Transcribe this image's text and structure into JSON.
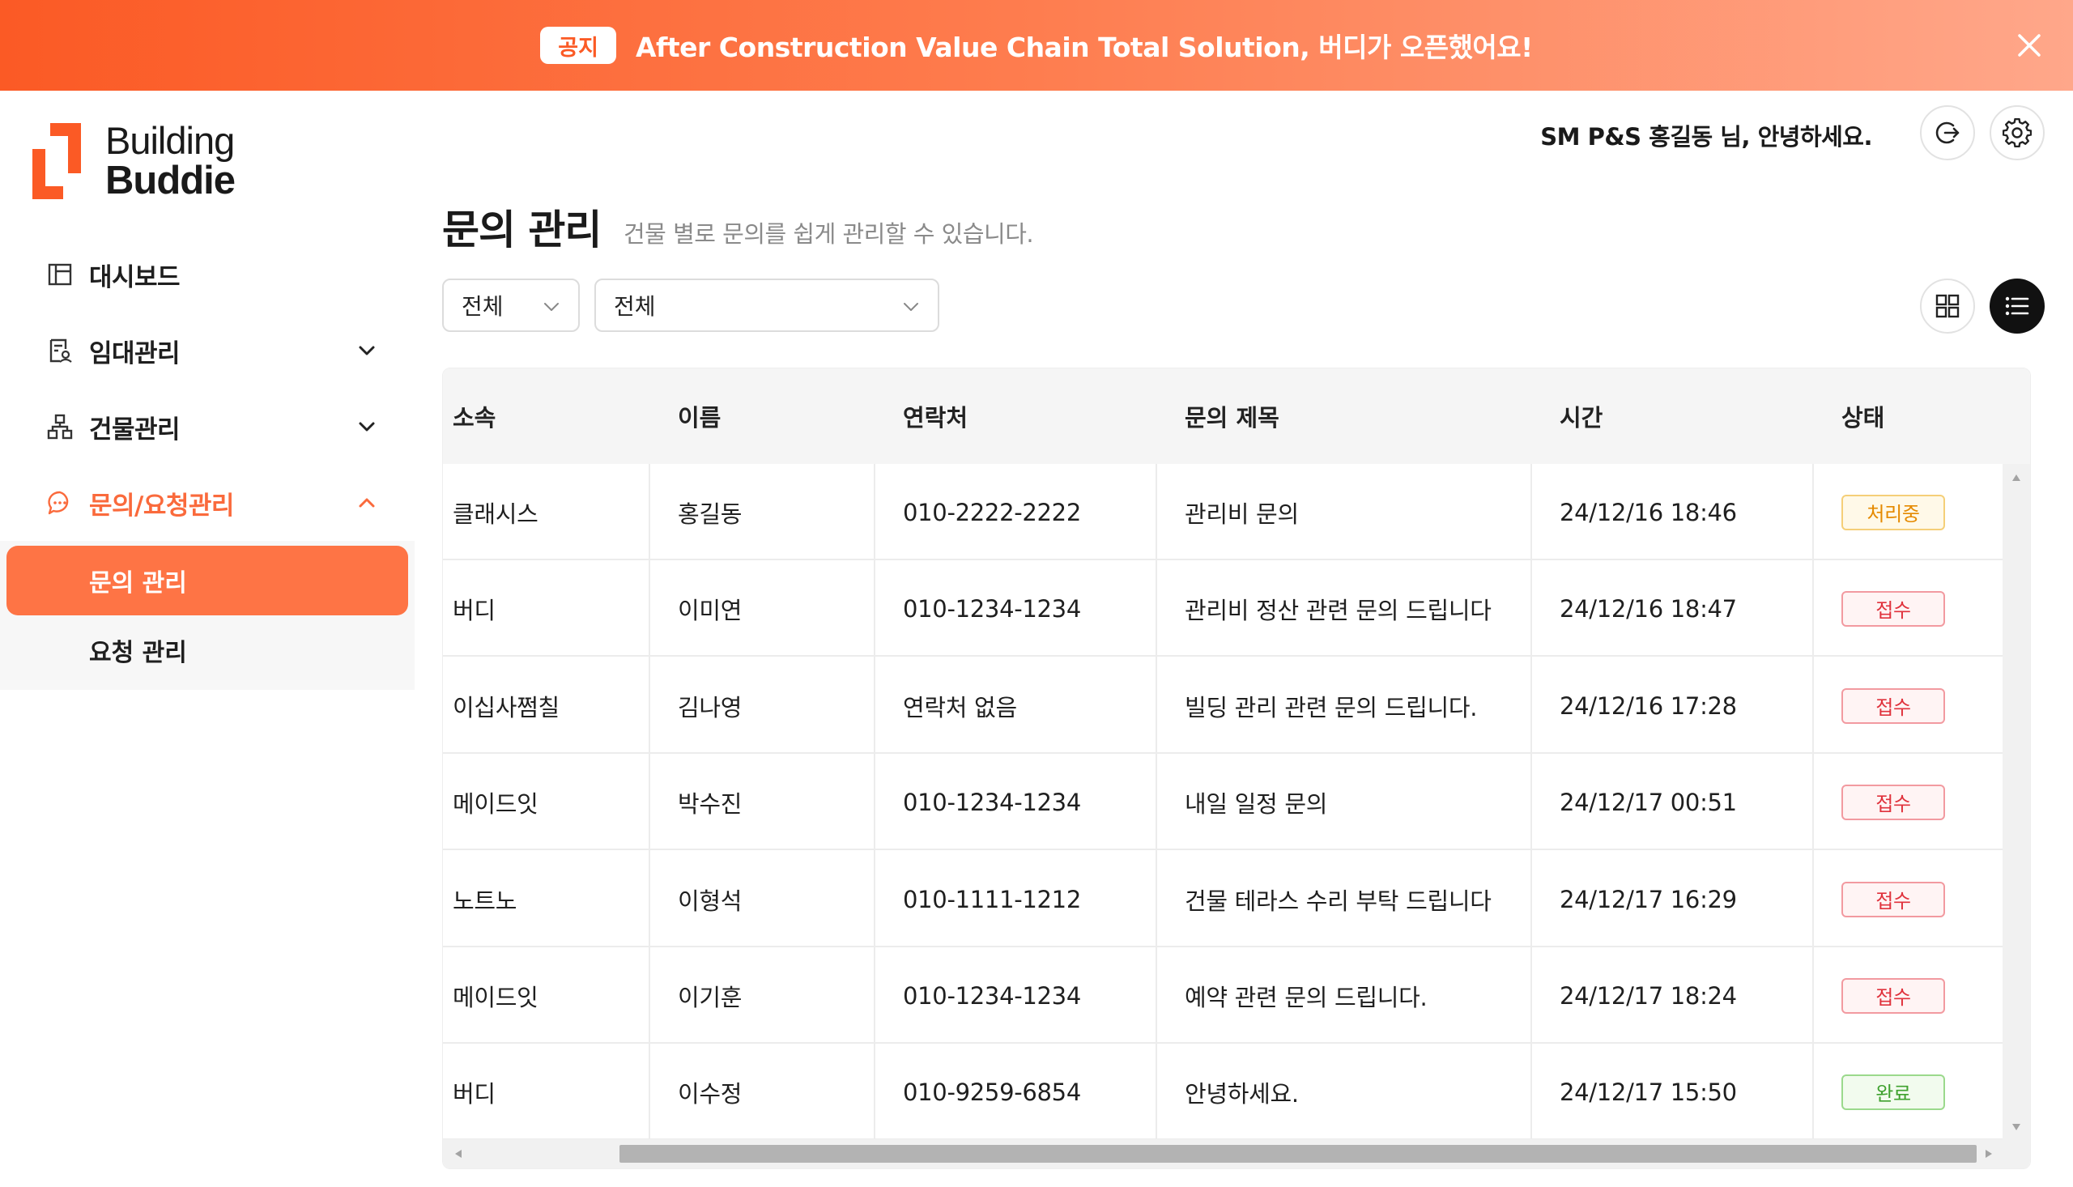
{
  "banner": {
    "badge": "공지",
    "text": "After Construction Value Chain Total Solution, 버디가 오픈했어요!",
    "close_icon": "close-icon"
  },
  "brand": {
    "line1": "Building",
    "line2": "Buddie",
    "accent": "#fb5a25"
  },
  "sidebar": {
    "items": [
      {
        "label": "대시보드",
        "icon": "dashboard-icon"
      },
      {
        "label": "임대관리",
        "icon": "contract-icon",
        "chevron": "chevron-down-icon"
      },
      {
        "label": "건물관리",
        "icon": "org-tree-icon",
        "chevron": "chevron-down-icon"
      },
      {
        "label": "문의/요청관리",
        "icon": "chat-icon",
        "chevron": "chevron-up-icon"
      }
    ],
    "sub_items": [
      {
        "label": "문의 관리"
      },
      {
        "label": "요청 관리"
      }
    ]
  },
  "header": {
    "greeting": "SM P&S 홍길동 님, 안녕하세요.",
    "logout_icon": "logout-icon",
    "settings_icon": "gear-icon"
  },
  "page": {
    "title": "문의 관리",
    "subtitle": "건물 별로 문의를 쉽게 관리할 수 있습니다."
  },
  "filters": {
    "first_value": "전체",
    "second_value": "전체"
  },
  "view_toggle": {
    "grid_icon": "grid-icon",
    "list_icon": "list-icon",
    "active": "list"
  },
  "table": {
    "columns": [
      "소속",
      "이름",
      "연락처",
      "문의 제목",
      "시간",
      "상태"
    ],
    "rows": [
      {
        "org": "클래시스",
        "name": "홍길동",
        "phone": "010-2222-2222",
        "subject": "관리비 문의",
        "time": "24/12/16 18:46",
        "status": "처리중"
      },
      {
        "org": "버디",
        "name": "이미연",
        "phone": "010-1234-1234",
        "subject": "관리비 정산 관련 문의 드립니다",
        "time": "24/12/16 18:47",
        "status": "접수"
      },
      {
        "org": "이십사쩜칠",
        "name": "김나영",
        "phone": "연락처 없음",
        "subject": "빌딩 관리 관련 문의 드립니다.",
        "time": "24/12/16 17:28",
        "status": "접수"
      },
      {
        "org": "메이드잇",
        "name": "박수진",
        "phone": "010-1234-1234",
        "subject": "내일 일정 문의",
        "time": "24/12/17 00:51",
        "status": "접수"
      },
      {
        "org": "노트노",
        "name": "이형석",
        "phone": "010-1111-1212",
        "subject": "건물 테라스 수리 부탁 드립니다",
        "time": "24/12/17 16:29",
        "status": "접수"
      },
      {
        "org": "메이드잇",
        "name": "이기훈",
        "phone": "010-1234-1234",
        "subject": "예약 관련 문의 드립니다.",
        "time": "24/12/17 18:24",
        "status": "접수"
      },
      {
        "org": "버디",
        "name": "이수정",
        "phone": "010-9259-6854",
        "subject": "안녕하세요.",
        "time": "24/12/17 15:50",
        "status": "완료"
      }
    ]
  },
  "status_colors": {
    "처리중": {
      "text": "#e58a00",
      "border": "#f5cf78",
      "bg": "#fff9e8"
    },
    "접수": {
      "text": "#e0323c",
      "border": "#f29aa0",
      "bg": "#fff4f4"
    },
    "완료": {
      "text": "#3fa12e",
      "border": "#9bd98c",
      "bg": "#f2fbee"
    }
  }
}
